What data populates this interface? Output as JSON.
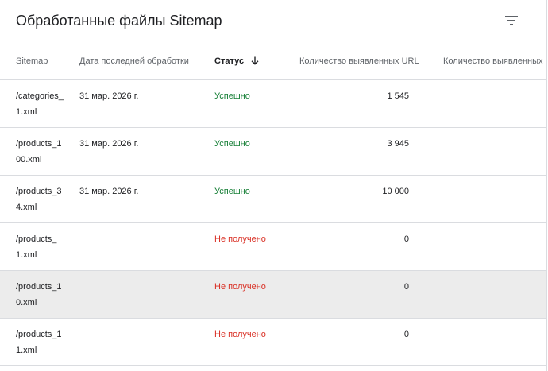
{
  "card": {
    "title": "Обработанные файлы Sitemap",
    "filter_icon": "filter-list-icon"
  },
  "columns": {
    "sitemap": "Sitemap",
    "date": "Дата последней обработки",
    "status": "Статус",
    "status_sort_icon": "arrow-down-icon",
    "urls": "Количество выявленных URL",
    "other": "Количество выявленных видео"
  },
  "rows": [
    {
      "sitemap": "/categories_\n1.xml",
      "date": "31 мар. 2026 г.",
      "status": "Успешно",
      "status_kind": "ok",
      "count": "1 545"
    },
    {
      "sitemap": "/products_1\n00.xml",
      "date": "31 мар. 2026 г.",
      "status": "Успешно",
      "status_kind": "ok",
      "count": "3 945"
    },
    {
      "sitemap": "/products_3\n4.xml",
      "date": "31 мар. 2026 г.",
      "status": "Успешно",
      "status_kind": "ok",
      "count": "10 000"
    },
    {
      "sitemap": "/products_\n1.xml",
      "date": "",
      "status": "Не получено",
      "status_kind": "fail",
      "count": "0"
    },
    {
      "sitemap": "/products_1\n0.xml",
      "date": "",
      "status": "Не получено",
      "status_kind": "fail",
      "count": "0"
    },
    {
      "sitemap": "/products_1\n1.xml",
      "date": "",
      "status": "Не получено",
      "status_kind": "fail",
      "count": "0"
    }
  ],
  "colors": {
    "success": "#188038",
    "error": "#d93025",
    "highlight_row": "#ececec"
  }
}
